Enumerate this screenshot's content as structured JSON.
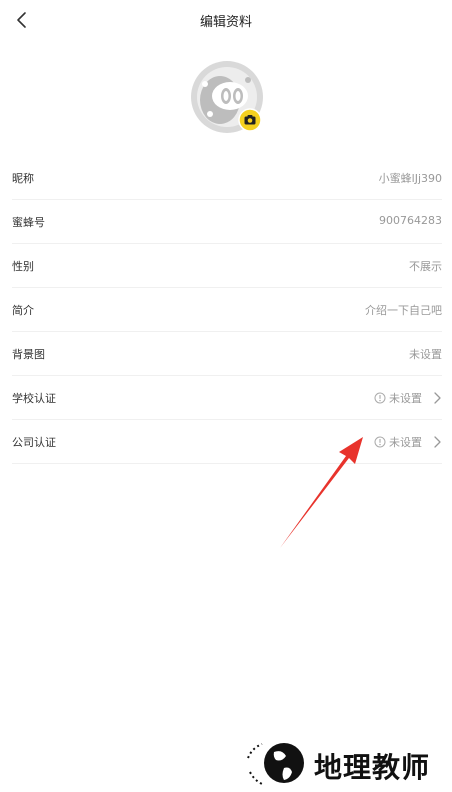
{
  "header": {
    "title": "编辑资料"
  },
  "fields": [
    {
      "label": "昵称",
      "value": "小蜜蜂lJj390"
    },
    {
      "label": "蜜蜂号",
      "value": "900764283"
    },
    {
      "label": "性别",
      "value": "不展示"
    },
    {
      "label": "简介",
      "value": "介绍一下自己吧"
    },
    {
      "label": "背景图",
      "value": "未设置"
    },
    {
      "label": "学校认证",
      "value": "未设置"
    },
    {
      "label": "公司认证",
      "value": "未设置"
    }
  ],
  "icons": {
    "back": "chevron-left-icon",
    "camera": "camera-icon",
    "info": "info-circle-icon",
    "chevron": "chevron-right-icon"
  },
  "colors": {
    "badge": "#f5d020",
    "annotation_arrow": "#e8332c"
  },
  "watermark": {
    "text": "地理教师"
  }
}
